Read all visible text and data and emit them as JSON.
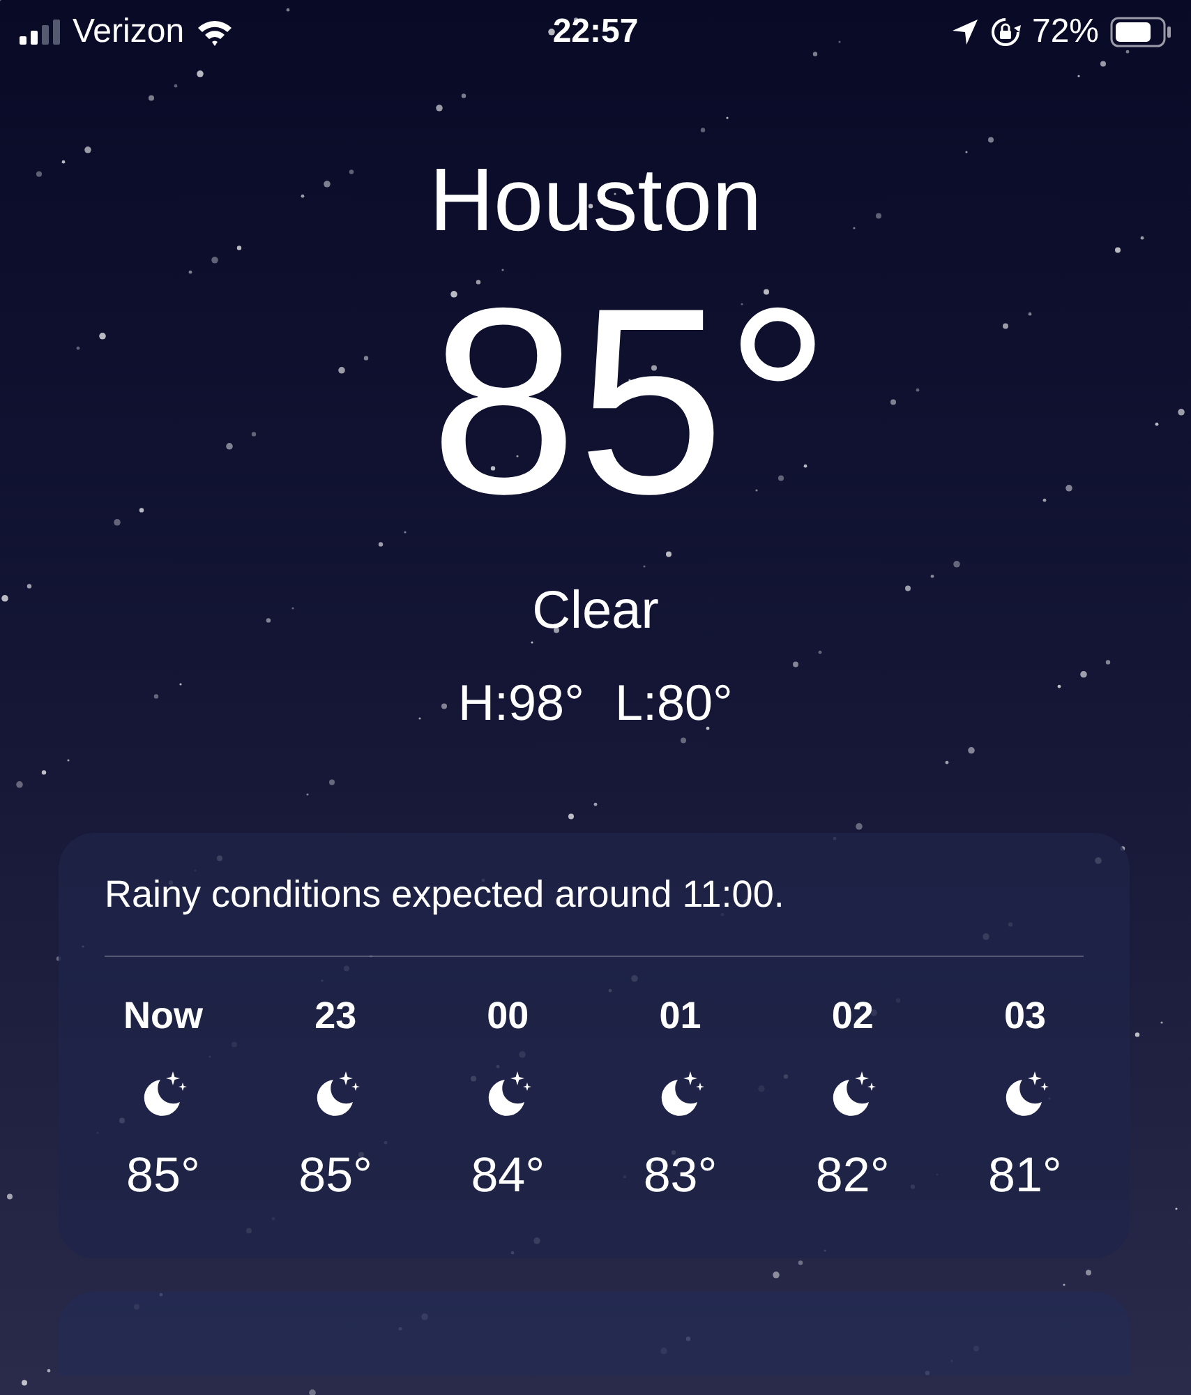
{
  "status_bar": {
    "carrier": "Verizon",
    "time": "22:57",
    "battery": "72%"
  },
  "location": {
    "city": "Houston",
    "temperature": "85°",
    "condition": "Clear",
    "high": "H:98°",
    "low": "L:80°"
  },
  "hourly_forecast": {
    "summary": "Rainy conditions expected around 11:00.",
    "hours": [
      {
        "time": "Now",
        "temperature": "85°"
      },
      {
        "time": "23",
        "temperature": "85°"
      },
      {
        "time": "00",
        "temperature": "84°"
      },
      {
        "time": "01",
        "temperature": "83°"
      },
      {
        "time": "02",
        "temperature": "82°"
      },
      {
        "time": "03",
        "temperature": "81°"
      }
    ]
  }
}
